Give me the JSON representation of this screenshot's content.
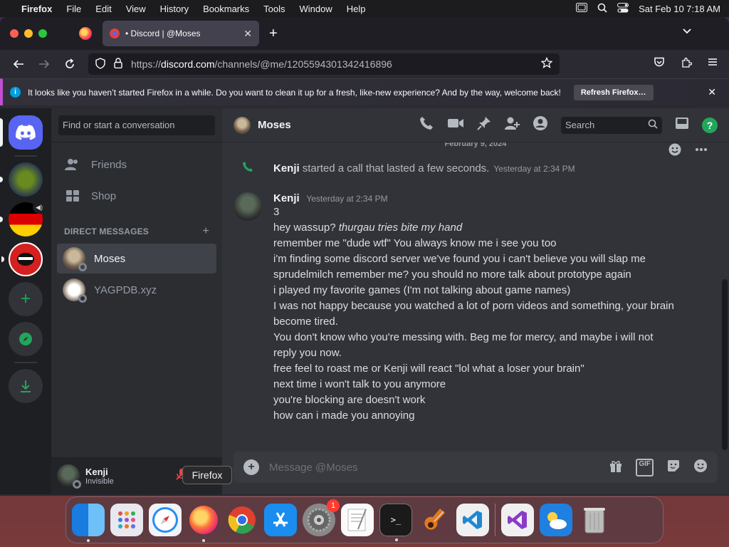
{
  "menubar": {
    "app": "Firefox",
    "items": [
      "File",
      "Edit",
      "View",
      "History",
      "Bookmarks",
      "Tools",
      "Window",
      "Help"
    ],
    "datetime": "Sat Feb 10  7:18 AM"
  },
  "browser": {
    "tab_title": "• Discord | @Moses",
    "url_proto": "https://",
    "url_host": "discord.com",
    "url_rest": "/channels/@me/1205594301342416896",
    "notification": "It looks like you haven’t started Firefox in a while. Do you want to clean it up for a fresh, like-new experience? And by the way, welcome back!",
    "refresh_label": "Refresh Firefox…"
  },
  "discord": {
    "search_placeholder": "Find or start a conversation",
    "nav": [
      {
        "label": "Friends",
        "icon": "friends-icon"
      },
      {
        "label": "Shop",
        "icon": "shop-icon"
      }
    ],
    "dm_header": "DIRECT MESSAGES",
    "dms": [
      {
        "name": "Moses",
        "active": true
      },
      {
        "name": "YAGPDB.xyz",
        "active": false
      }
    ],
    "user": {
      "name": "Kenji",
      "status": "Invisible"
    },
    "channel": {
      "name": "Moses",
      "search": "Search",
      "date_divider": "February 9, 2024",
      "call": {
        "author": "Kenji",
        "text": "started a call that lasted a few seconds.",
        "time": "Yesterday at 2:34 PM"
      },
      "message": {
        "author": "Kenji",
        "time": "Yesterday at 2:34 PM",
        "lines": [
          "3",
          "hey wassup? ",
          "remember me \"dude wtf\" You always know me i see you too",
          "i'm finding some discord server we've found you i can't believe you will slap me",
          "sprudelmilch remember me? you should no more talk about prototype again",
          "i played my favorite games (I'm not talking about game names)",
          "I was not happy because you watched a lot of porn videos and something, your brain",
          "become tired.",
          "You don't know who you're messing with. Beg me for mercy, and maybe i will not",
          "reply you now.",
          "free feel to roast me or Kenji will react \"lol what a loser your brain\"",
          "next time i won't talk to you anymore",
          "you're blocking are doesn't work",
          "how can i made you annoying"
        ],
        "italic_part": "thurgau tries bite my hand"
      },
      "composer_placeholder": "Message @Moses"
    }
  },
  "tooltip": "Firefox",
  "dock": {
    "settings_badge": "1"
  },
  "colors": {
    "discord_blurple": "#5865f2",
    "discord_green": "#23a55a",
    "firefox_orange": "#ff7139"
  }
}
